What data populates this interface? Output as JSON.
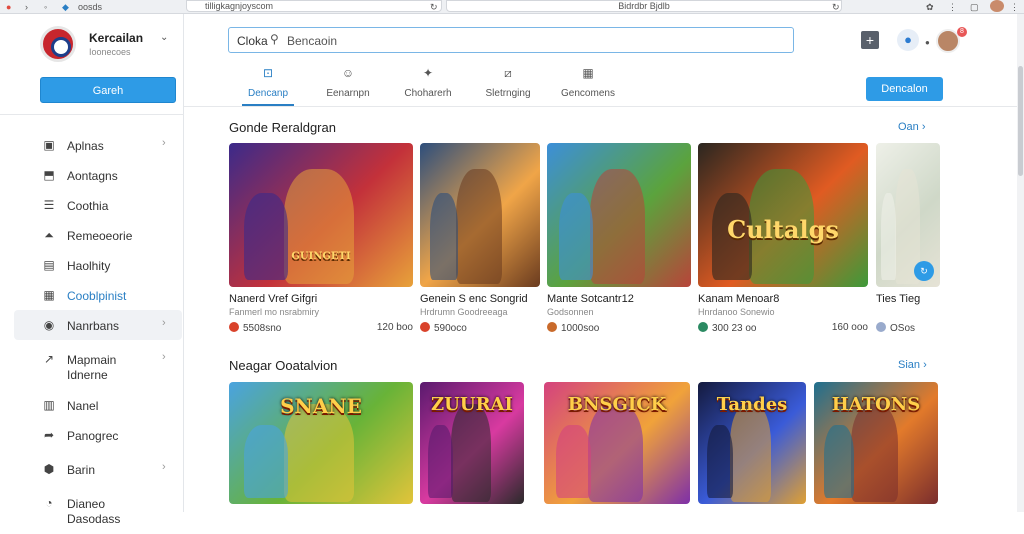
{
  "browser": {
    "url": "tilligkagnjoyscom",
    "tab_title": "Bidrdbr Bjdlb",
    "left_label": "oosds"
  },
  "sidebar": {
    "brand_name": "Kercailan",
    "brand_sub": "Ioonecoes",
    "primary_button": "Gareh",
    "items": [
      {
        "label": "Aplnas",
        "icon": "image-icon"
      },
      {
        "label": "Aontagns",
        "icon": "inbox-icon"
      },
      {
        "label": "Coothia",
        "icon": "list-icon"
      },
      {
        "label": "Remeoeorie",
        "icon": "upload-icon"
      },
      {
        "label": "Haolhity",
        "icon": "chart-icon"
      },
      {
        "label": "Cooblpinist",
        "icon": "calendar-icon"
      },
      {
        "label": "Nanrbans",
        "icon": "compass-icon"
      },
      {
        "label": "Mapmain",
        "label2": "Idnerne",
        "icon": "trend-icon"
      },
      {
        "label": "Nanel",
        "icon": "book-icon"
      },
      {
        "label": "Panogrec",
        "icon": "share-icon"
      },
      {
        "label": "Barin",
        "icon": "shield-icon"
      },
      {
        "label": "Dianeo",
        "label2": "Dasodass",
        "icon": "clock-icon"
      }
    ]
  },
  "header": {
    "search_prefix": "Cloka",
    "search_text": "Bencaoin",
    "cta": "Dencalon",
    "badge": "8"
  },
  "tabs": [
    {
      "label": "Dencanp",
      "icon": "⊡"
    },
    {
      "label": "Eenarnpn",
      "icon": "☺"
    },
    {
      "label": "Choharerh",
      "icon": "✦"
    },
    {
      "label": "Sletrnging",
      "icon": "⧄"
    },
    {
      "label": "Gencomens",
      "icon": "▦"
    }
  ],
  "section1": {
    "title": "Gonde Reraldgran",
    "see_all": "Oan",
    "cards": [
      {
        "title": "Nanerd Vref Gifgri",
        "sub": "Fanmerl mo nsrabmiry",
        "meta": "5508sno",
        "meta2": "120 boo",
        "dot": "#d9422b",
        "colors": [
          "#3b2a8a",
          "#c3313a",
          "#e8a23a"
        ],
        "overlay": "GUINGETI"
      },
      {
        "title": "Genein S enc Songrid",
        "sub": "Hrdrumn Goodreeaga",
        "meta": "590oco",
        "meta2": "",
        "dot": "#d9422b",
        "colors": [
          "#2d4e7c",
          "#f0a548",
          "#6a3b1f"
        ],
        "overlay": ""
      },
      {
        "title": "Mante Sotcantr12",
        "sub": "Godsonnen",
        "meta": "1000soo",
        "meta2": "",
        "dot": "#c96a2b",
        "colors": [
          "#3c8fd9",
          "#5ba33d",
          "#b8443a"
        ],
        "overlay": ""
      },
      {
        "title": "Kanam Menoar8",
        "sub": "Hnrdanoo Sonewio",
        "meta": "300 23 oo",
        "meta2": "160 ooo",
        "dot": "#2b8a62",
        "colors": [
          "#2a2620",
          "#e05b22",
          "#3d9a3a"
        ],
        "overlay": "Cultalgs"
      },
      {
        "title": "Ties Tieg",
        "sub": "",
        "meta": "OSos",
        "meta2": "",
        "dot": "#9ac",
        "colors": [
          "#eef0e8",
          "#cfd8c8",
          "#e6e3d6"
        ],
        "overlay": ""
      }
    ]
  },
  "section2": {
    "title": "Neagar Ooatalvion",
    "see_all": "Sian",
    "cards": [
      {
        "overlay": "SNANE",
        "colors": [
          "#4aa3e0",
          "#68b338",
          "#e2c43a"
        ]
      },
      {
        "overlay": "ZUURAI",
        "colors": [
          "#5a1a6e",
          "#d83aa0",
          "#2a2a2a"
        ]
      },
      {
        "overlay": "BNSGICK",
        "colors": [
          "#d4427e",
          "#f0a23a",
          "#7e2fa8"
        ]
      },
      {
        "overlay": "Tandes",
        "colors": [
          "#141a3e",
          "#3a5bd8",
          "#e0a033"
        ]
      },
      {
        "overlay": "HATONS",
        "colors": [
          "#1f6f8f",
          "#e27a2b",
          "#7a2d2d"
        ]
      }
    ]
  }
}
